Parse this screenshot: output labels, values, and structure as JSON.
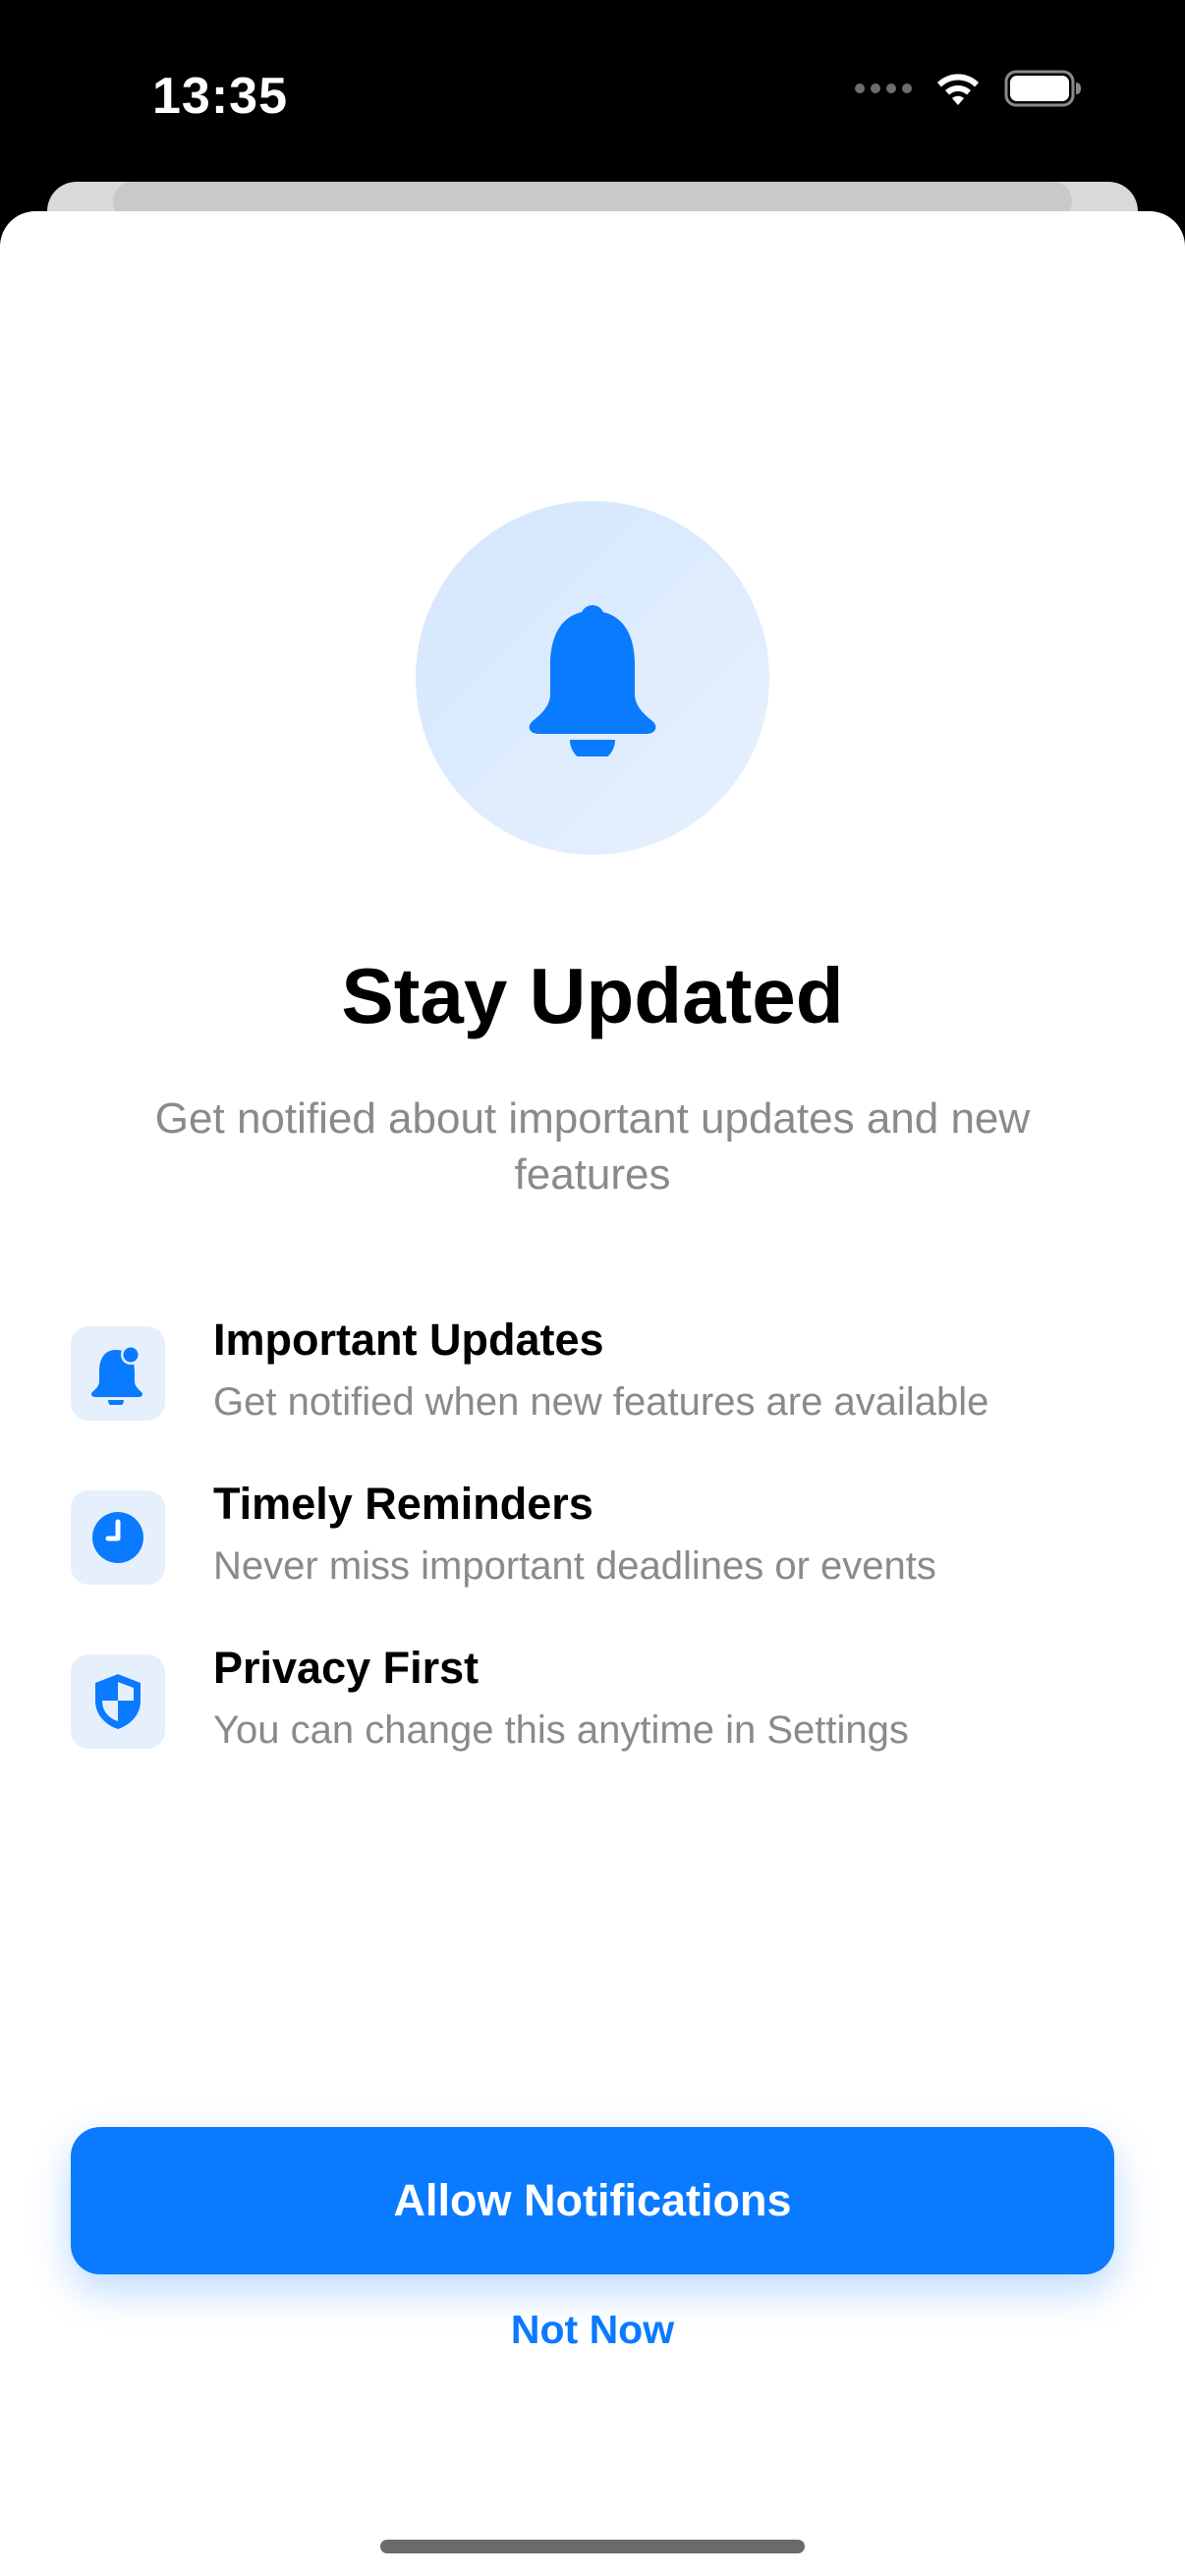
{
  "status_bar": {
    "time": "13:35"
  },
  "hero": {
    "icon": "bell-icon",
    "title": "Stay Updated",
    "subtitle": "Get notified about important updates and new features"
  },
  "features": [
    {
      "icon": "bell-badge-icon",
      "title": "Important Updates",
      "description": "Get notified when new features are available"
    },
    {
      "icon": "clock-icon",
      "title": "Timely Reminders",
      "description": "Never miss important deadlines or events"
    },
    {
      "icon": "shield-icon",
      "title": "Privacy First",
      "description": "You can change this anytime in Settings"
    }
  ],
  "actions": {
    "primary_label": "Allow Notifications",
    "secondary_label": "Not Now"
  },
  "colors": {
    "accent": "#0a7aff",
    "icon_bg": "#e6f0fd",
    "secondary_text": "#8a8a8e"
  }
}
